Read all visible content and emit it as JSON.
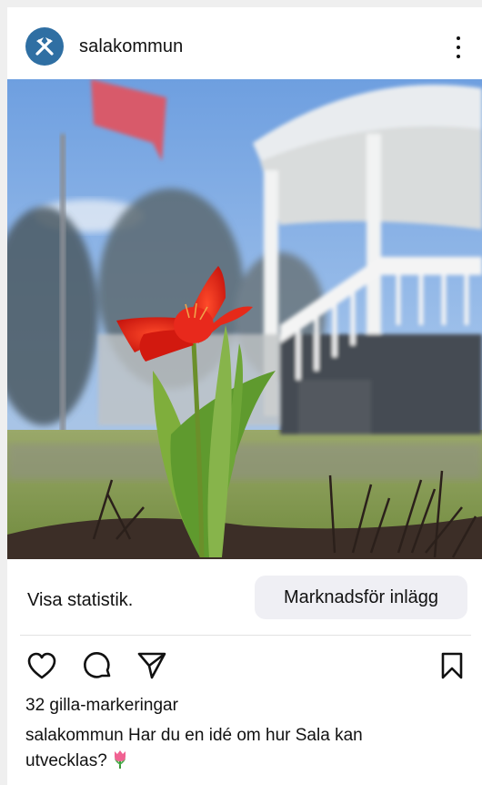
{
  "post": {
    "username": "salakommun",
    "avatar_icon": "sala-kommun-logo-icon",
    "more_icon": "more-vertical-icon",
    "image_description_icon": "photo"
  },
  "actions": {
    "stats_label": "Visa statistik.",
    "promote_label": "Marknadsför inlägg",
    "like_icon": "heart-icon",
    "comment_icon": "comment-icon",
    "share_icon": "send-icon",
    "save_icon": "bookmark-icon"
  },
  "engagement": {
    "likes_text": "32 gilla-markeringar"
  },
  "caption": {
    "username": "salakommun",
    "text": " Har du en idé om hur Sala kan utvecklas? "
  },
  "colors": {
    "avatar_bg": "#2f6fa3",
    "promote_bg": "#efeff4",
    "tulip_red": "#e8291c"
  }
}
